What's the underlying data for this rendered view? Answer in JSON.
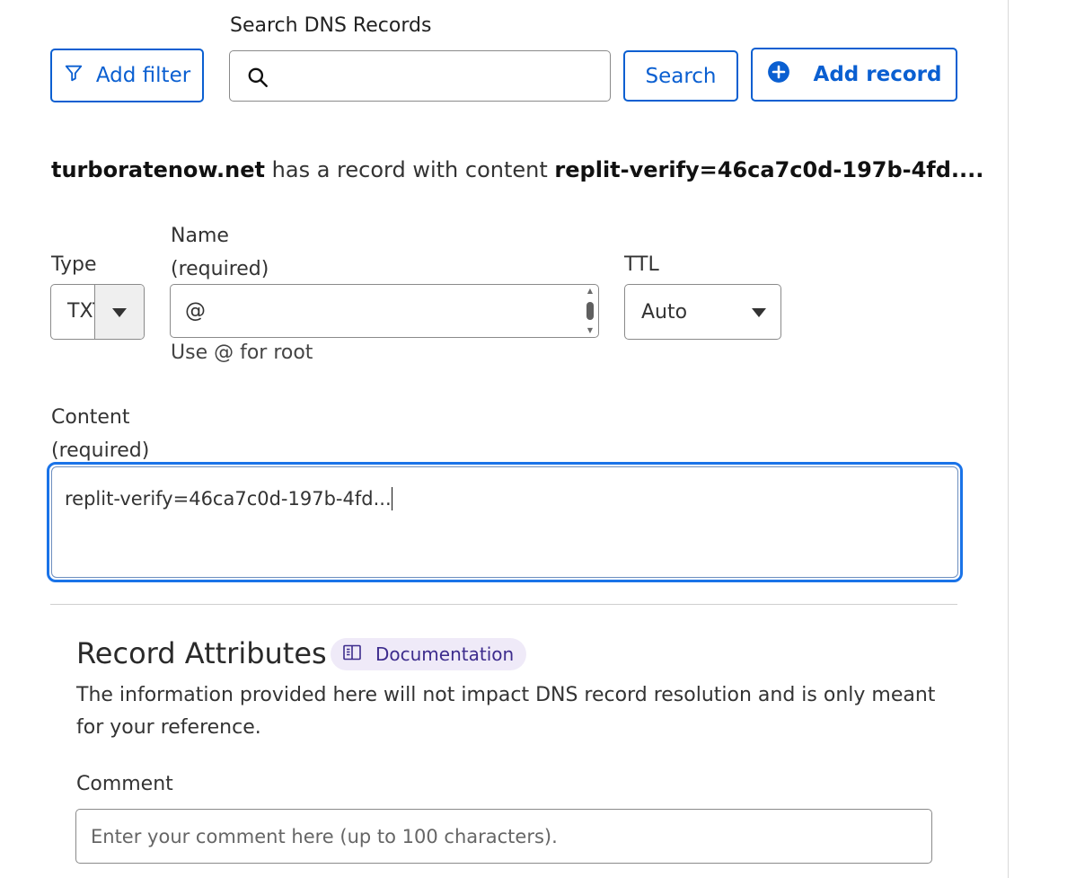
{
  "search": {
    "label": "Search DNS Records",
    "placeholder": "",
    "value": "",
    "button_label": "Search"
  },
  "toolbar": {
    "filter_label": "Add filter",
    "add_record_label": "Add record"
  },
  "summary": {
    "domain": "turboratenow.net",
    "middle_text": "has a record with content",
    "content": "replit-verify=46ca7c0d-197b-4fd...."
  },
  "form": {
    "type": {
      "label": "Type",
      "value": "TXT"
    },
    "name": {
      "label_line1": "Name",
      "label_line2": "(required)",
      "value": "@",
      "hint": "Use @ for root"
    },
    "ttl": {
      "label": "TTL",
      "value": "Auto"
    },
    "content": {
      "label_line1": "Content",
      "label_line2": "(required)",
      "value": "replit-verify=46ca7c0d-197b-4fd..."
    }
  },
  "attributes": {
    "title": "Record Attributes",
    "doc_label": "Documentation",
    "description": "The information provided here will not impact DNS record resolution and is only meant for your reference.",
    "comment_label": "Comment",
    "comment_placeholder": "Enter your comment here (up to 100 characters)."
  },
  "colors": {
    "accent": "#0a5fd1",
    "focus": "#1a73e8",
    "doc_pill_bg": "#efeaf8",
    "doc_pill_text": "#3d2c8d"
  }
}
